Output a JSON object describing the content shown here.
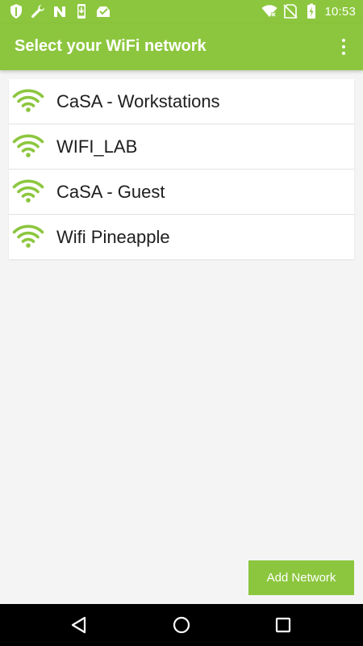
{
  "status_bar": {
    "time": "10:53",
    "left_icons": [
      "shield-icon",
      "wrench-icon",
      "n-notification-icon",
      "phone-download-icon",
      "inbox-check-icon"
    ],
    "right_icons": [
      "wifi-x-icon",
      "no-sim-icon",
      "battery-charging-icon"
    ]
  },
  "app_bar": {
    "title": "Select your WiFi network",
    "menu_icon": "overflow-menu-icon"
  },
  "networks": [
    {
      "name": "CaSA - Workstations",
      "icon": "wifi-icon"
    },
    {
      "name": "WIFI_LAB",
      "icon": "wifi-icon"
    },
    {
      "name": "CaSA - Guest",
      "icon": "wifi-icon"
    },
    {
      "name": "Wifi Pineapple",
      "icon": "wifi-icon"
    }
  ],
  "add_network_label": "Add Network",
  "nav": {
    "icons": [
      "back-icon",
      "home-icon",
      "recents-icon"
    ]
  },
  "colors": {
    "accent": "#8cc63e",
    "background": "#f4f4f4",
    "list_background": "#ffffff",
    "text": "#1e1e1e",
    "nav_bar": "#000000"
  }
}
